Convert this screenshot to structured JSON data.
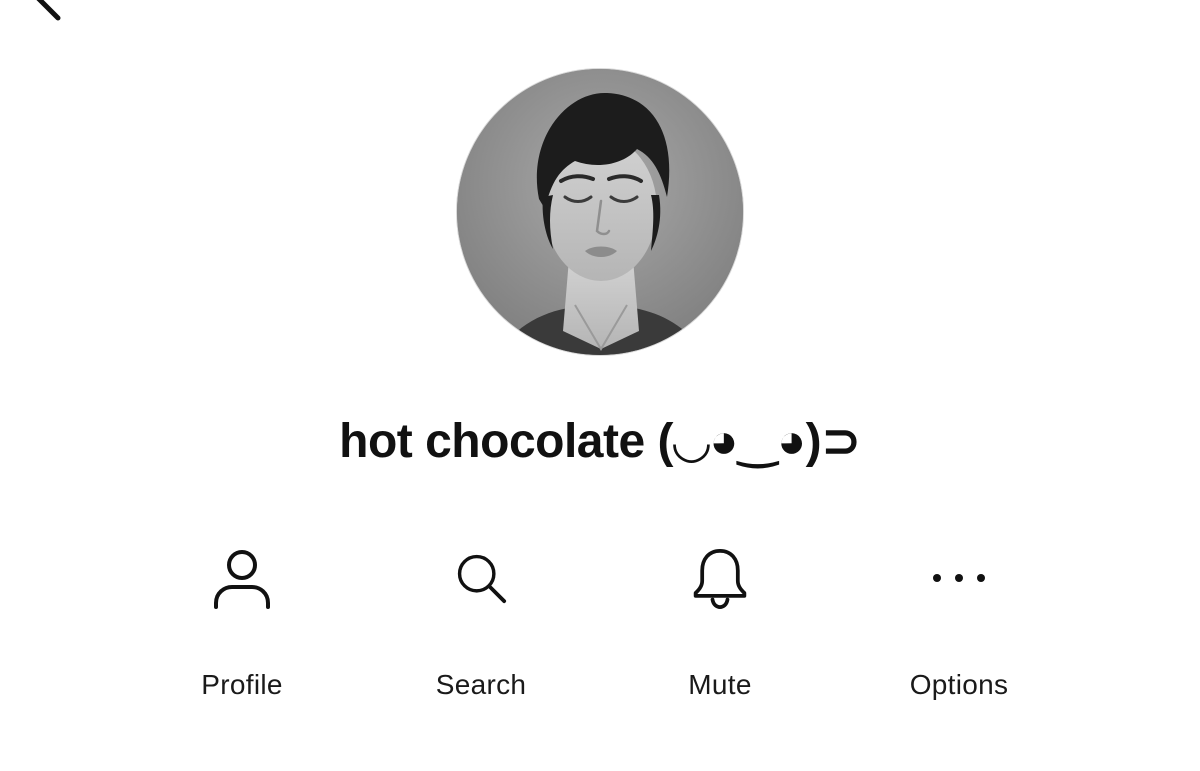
{
  "header": {
    "back_icon": "back-arrow-icon"
  },
  "profile": {
    "avatar_description_icon": "avatar-photo",
    "name": "hot chocolate (◡◕‿◕)⊃"
  },
  "actions": [
    {
      "id": "profile",
      "label": "Profile",
      "icon": "person-icon"
    },
    {
      "id": "search",
      "label": "Search",
      "icon": "search-icon"
    },
    {
      "id": "mute",
      "label": "Mute",
      "icon": "bell-icon"
    },
    {
      "id": "options",
      "label": "Options",
      "icon": "more-horizontal-icon"
    }
  ],
  "colors": {
    "background": "#ffffff",
    "text": "#111111",
    "icon": "#111111"
  }
}
